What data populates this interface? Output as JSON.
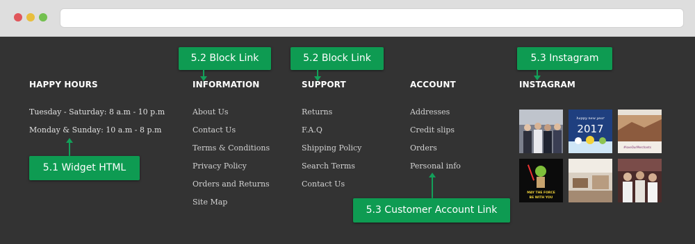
{
  "footer": {
    "happy_hours": {
      "title": "HAPPY HOURS",
      "lines": [
        "Tuesday - Saturday: 8 a.m - 10 p.m",
        "Monday & Sunday: 10 a.m - 8 p.m"
      ]
    },
    "information": {
      "title": "INFORMATION",
      "links": [
        "About Us",
        "Contact Us",
        "Terms & Conditions",
        "Privacy Policy",
        "Orders and Returns",
        "Site Map"
      ]
    },
    "support": {
      "title": "SUPPORT",
      "links": [
        "Returns",
        "F.A.Q",
        "Shipping Policy",
        "Search Terms",
        "Contact Us"
      ]
    },
    "account": {
      "title": "ACCOUNT",
      "links": [
        "Addresses",
        "Credit slips",
        "Orders",
        "Personal info"
      ]
    },
    "instagram": {
      "title": "INSTAGRAM",
      "photos": [
        {
          "icon": "group-photo"
        },
        {
          "icon": "happy-new-year-2017-card",
          "caption_small": "happy new year",
          "caption_big": "2017"
        },
        {
          "icon": "desert-landscape-photo"
        },
        {
          "icon": "star-wars-poster",
          "caption": "MAY THE FORCE BE WITH YOU"
        },
        {
          "icon": "office-interior-photo"
        },
        {
          "icon": "people-photo"
        }
      ]
    }
  },
  "annotations": {
    "widget_html": "5.1 Widget HTML",
    "block_link_info": "5.2 Block Link",
    "block_link_support": "5.2 Block Link",
    "customer_account_link": "5.3 Customer Account Link",
    "instagram": "5.3 Instagram"
  },
  "colors": {
    "footer_bg": "#333333",
    "annotation_green": "#0e9b52",
    "link_text": "#d2d2d2"
  }
}
